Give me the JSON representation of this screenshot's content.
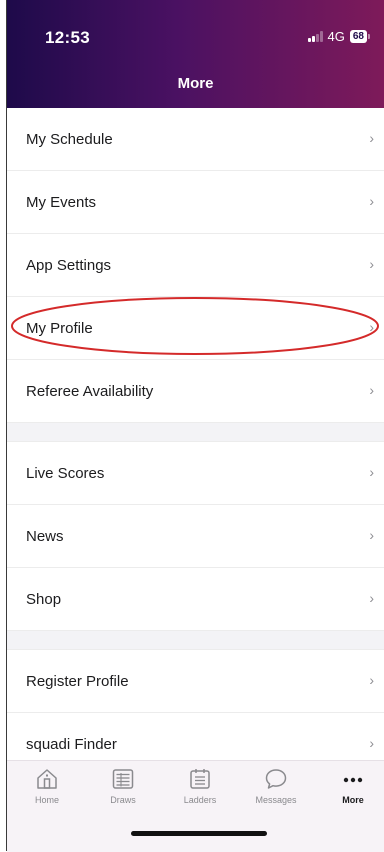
{
  "status_bar": {
    "time": "12:53",
    "network": "4G",
    "battery": "68"
  },
  "header": {
    "title": "More"
  },
  "menu": {
    "group1": [
      {
        "label": "My Schedule"
      },
      {
        "label": "My Events"
      },
      {
        "label": "App Settings"
      },
      {
        "label": "My Profile"
      },
      {
        "label": "Referee Availability"
      }
    ],
    "group2": [
      {
        "label": "Live Scores"
      },
      {
        "label": "News"
      },
      {
        "label": "Shop"
      }
    ],
    "group3": [
      {
        "label": "Register Profile"
      },
      {
        "label": "squadi Finder"
      }
    ],
    "chevron": "›"
  },
  "tabbar": {
    "items": [
      {
        "label": "Home",
        "icon": "home-icon"
      },
      {
        "label": "Draws",
        "icon": "draws-icon"
      },
      {
        "label": "Ladders",
        "icon": "ladders-icon"
      },
      {
        "label": "Messages",
        "icon": "messages-icon"
      },
      {
        "label": "More",
        "icon": "more-icon",
        "active": true
      }
    ]
  },
  "colors": {
    "header_start": "#1e0a4a",
    "header_end": "#7e1a5a",
    "highlight": "#d42a2a"
  }
}
